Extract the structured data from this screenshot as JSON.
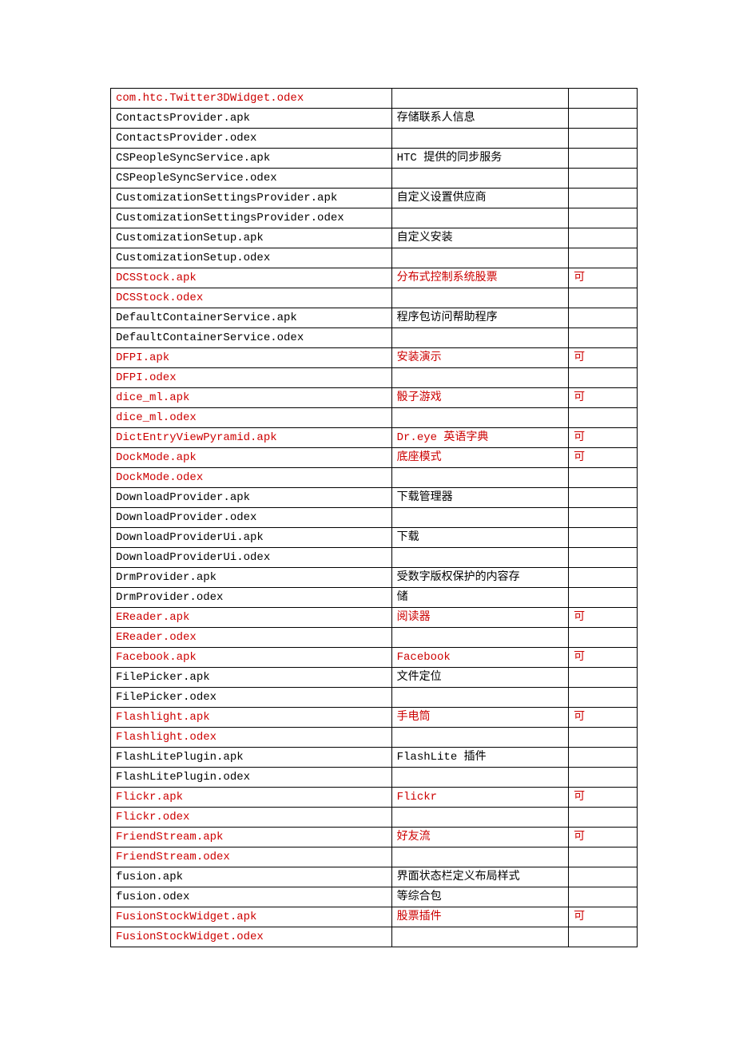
{
  "rows": [
    {
      "file": "com.htc.Twitter3DWidget.odex",
      "desc": "",
      "mark": "",
      "red": true
    },
    {
      "file": "ContactsProvider.apk",
      "desc": "存储联系人信息",
      "mark": "",
      "red": false
    },
    {
      "file": "ContactsProvider.odex",
      "desc": "",
      "mark": "",
      "red": false
    },
    {
      "file": "CSPeopleSyncService.apk",
      "desc": "HTC 提供的同步服务",
      "mark": "",
      "red": false
    },
    {
      "file": "CSPeopleSyncService.odex",
      "desc": "",
      "mark": "",
      "red": false
    },
    {
      "file": "CustomizationSettingsProvider.apk",
      "desc": "自定义设置供应商",
      "mark": "",
      "red": false
    },
    {
      "file": "CustomizationSettingsProvider.odex",
      "desc": "",
      "mark": "",
      "red": false
    },
    {
      "file": "CustomizationSetup.apk",
      "desc": "自定义安装",
      "mark": "",
      "red": false
    },
    {
      "file": "CustomizationSetup.odex",
      "desc": "",
      "mark": "",
      "red": false
    },
    {
      "file": "DCSStock.apk",
      "desc": "分布式控制系统股票",
      "mark": "可",
      "red": true
    },
    {
      "file": "DCSStock.odex",
      "desc": "",
      "mark": "",
      "red": true
    },
    {
      "file": "DefaultContainerService.apk",
      "desc": "程序包访问帮助程序",
      "mark": "",
      "red": false
    },
    {
      "file": "DefaultContainerService.odex",
      "desc": "",
      "mark": "",
      "red": false
    },
    {
      "file": "DFPI.apk",
      "desc": "安装演示",
      "mark": "可",
      "red": true
    },
    {
      "file": "DFPI.odex",
      "desc": "",
      "mark": "",
      "red": true
    },
    {
      "file": "dice_ml.apk",
      "desc": "骰子游戏",
      "mark": "可",
      "red": true
    },
    {
      "file": "dice_ml.odex",
      "desc": "",
      "mark": "",
      "red": true
    },
    {
      "file": "DictEntryViewPyramid.apk",
      "desc": "Dr.eye 英语字典",
      "mark": "可",
      "red": true
    },
    {
      "file": "DockMode.apk",
      "desc": "底座模式",
      "mark": "可",
      "red": true
    },
    {
      "file": "DockMode.odex",
      "desc": "",
      "mark": "",
      "red": true
    },
    {
      "file": "DownloadProvider.apk",
      "desc": "下载管理器",
      "mark": "",
      "red": false
    },
    {
      "file": "DownloadProvider.odex",
      "desc": "",
      "mark": "",
      "red": false
    },
    {
      "file": "DownloadProviderUi.apk",
      "desc": "下载",
      "mark": "",
      "red": false
    },
    {
      "file": "DownloadProviderUi.odex",
      "desc": "",
      "mark": "",
      "red": false
    },
    {
      "file": "DrmProvider.apk",
      "desc": "受数字版权保护的内容存",
      "mark": "",
      "red": false
    },
    {
      "file": "DrmProvider.odex",
      "desc": "储",
      "mark": "",
      "red": false
    },
    {
      "file": "EReader.apk",
      "desc": "阅读器",
      "mark": "可",
      "red": true
    },
    {
      "file": "EReader.odex",
      "desc": "",
      "mark": "",
      "red": true
    },
    {
      "file": "Facebook.apk",
      "desc": "Facebook",
      "mark": "可",
      "red": true
    },
    {
      "file": "FilePicker.apk",
      "desc": "文件定位",
      "mark": "",
      "red": false
    },
    {
      "file": "FilePicker.odex",
      "desc": "",
      "mark": "",
      "red": false
    },
    {
      "file": "Flashlight.apk",
      "desc": "手电筒",
      "mark": "可",
      "red": true
    },
    {
      "file": "Flashlight.odex",
      "desc": "",
      "mark": "",
      "red": true
    },
    {
      "file": "FlashLitePlugin.apk",
      "desc": "FlashLite 插件",
      "mark": "",
      "red": false
    },
    {
      "file": "FlashLitePlugin.odex",
      "desc": "",
      "mark": "",
      "red": false
    },
    {
      "file": "Flickr.apk",
      "desc": "Flickr",
      "mark": "可",
      "red": true
    },
    {
      "file": "Flickr.odex",
      "desc": "",
      "mark": "",
      "red": true
    },
    {
      "file": "FriendStream.apk",
      "desc": "好友流",
      "mark": "可",
      "red": true
    },
    {
      "file": "FriendStream.odex",
      "desc": "",
      "mark": "",
      "red": true
    },
    {
      "file": "fusion.apk",
      "desc": "界面状态栏定义布局样式",
      "mark": "",
      "red": false
    },
    {
      "file": "fusion.odex",
      "desc": "等综合包",
      "mark": "",
      "red": false
    },
    {
      "file": "FusionStockWidget.apk",
      "desc": "股票插件",
      "mark": "可",
      "red": true
    },
    {
      "file": "FusionStockWidget.odex",
      "desc": "",
      "mark": "",
      "red": true
    }
  ]
}
